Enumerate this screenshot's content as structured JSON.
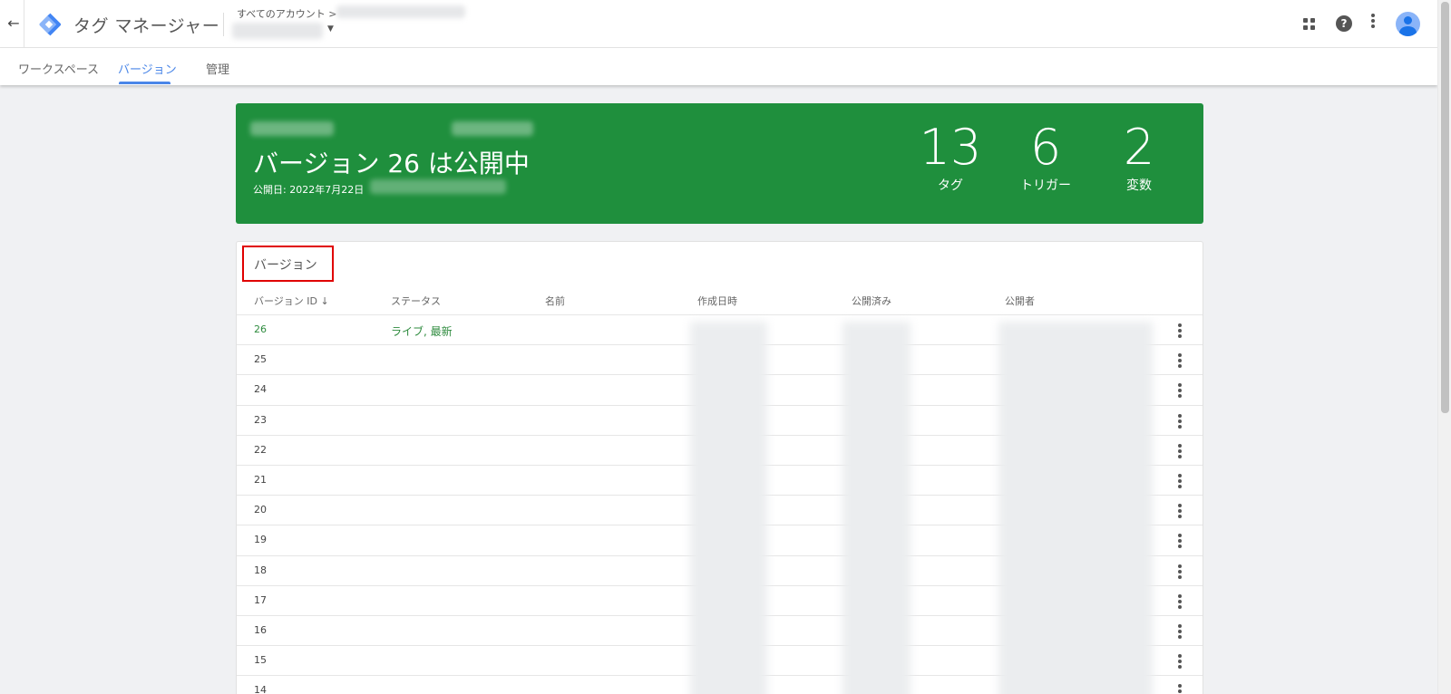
{
  "app": {
    "title": "タグ マネージャー",
    "breadcrumb": "すべてのアカウント >"
  },
  "tabs": [
    {
      "label": "ワークスペース"
    },
    {
      "label": "バージョン"
    },
    {
      "label": "管理"
    }
  ],
  "hero": {
    "title": "バージョン 26 は公開中",
    "published_date": "公開日: 2022年7月22日",
    "stats": [
      {
        "value": "13",
        "label": "タグ"
      },
      {
        "value": "6",
        "label": "トリガー"
      },
      {
        "value": "2",
        "label": "変数"
      }
    ],
    "color": "#1f8f3d"
  },
  "versions_table": {
    "title": "バージョン",
    "columns": [
      "バージョン ID ↓",
      "ステータス",
      "名前",
      "作成日時",
      "公開済み",
      "公開者"
    ],
    "rows": [
      {
        "id": "26",
        "status": "ライブ, 最新"
      },
      {
        "id": "25",
        "status": ""
      },
      {
        "id": "24",
        "status": ""
      },
      {
        "id": "23",
        "status": ""
      },
      {
        "id": "22",
        "status": ""
      },
      {
        "id": "21",
        "status": ""
      },
      {
        "id": "20",
        "status": ""
      },
      {
        "id": "19",
        "status": ""
      },
      {
        "id": "18",
        "status": ""
      },
      {
        "id": "17",
        "status": ""
      },
      {
        "id": "16",
        "status": ""
      },
      {
        "id": "15",
        "status": ""
      },
      {
        "id": "14",
        "status": ""
      }
    ]
  },
  "icons": {
    "back": "arrow-left-icon",
    "logo": "tag-manager-logo",
    "apps": "apps-grid-icon",
    "help": "help-icon",
    "more": "more-vert-icon",
    "avatar": "account-avatar"
  },
  "colors": {
    "accent": "#4a86e8",
    "live": "#2e8b3e",
    "highlight_border": "#e00000"
  }
}
